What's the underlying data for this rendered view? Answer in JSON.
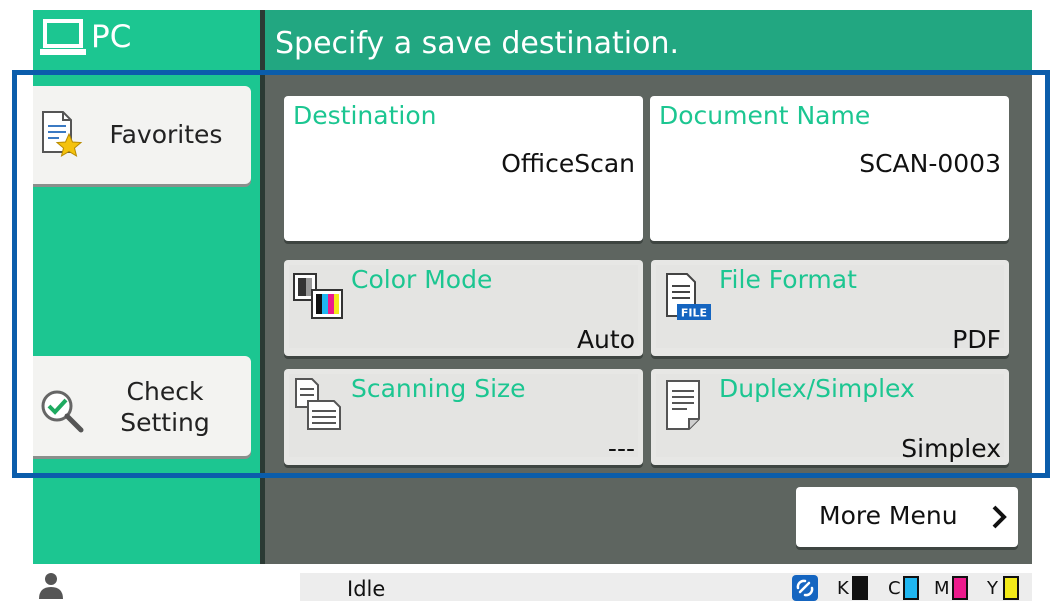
{
  "header": {
    "mode_label": "PC",
    "title": "Specify a save destination."
  },
  "sidebar": {
    "favorites_label": "Favorites",
    "check_setting_line1": "Check",
    "check_setting_line2": "Setting"
  },
  "settings": {
    "destination": {
      "title": "Destination",
      "value": "OfficeScan"
    },
    "document_name": {
      "title": "Document Name",
      "value": "SCAN-0003"
    },
    "color_mode": {
      "title": "Color Mode",
      "value": "Auto"
    },
    "file_format": {
      "title": "File Format",
      "value": "PDF",
      "icon_badge": "FILE"
    },
    "scanning_size": {
      "title": "Scanning Size",
      "value": "---"
    },
    "duplex_simplex": {
      "title": "Duplex/Simplex",
      "value": "Simplex"
    }
  },
  "more_menu_label": "More Menu",
  "status_bar": {
    "status_text": "Idle",
    "toner": [
      {
        "label": "K",
        "color": "#111111"
      },
      {
        "label": "C",
        "color": "#1fb6f0"
      },
      {
        "label": "M",
        "color": "#ec1b8c"
      },
      {
        "label": "Y",
        "color": "#f3ea19"
      }
    ]
  },
  "colors": {
    "accent_green": "#1cc691",
    "header_dark_green": "#22a781",
    "panel_grey": "#5e6560",
    "highlight_blue": "#0b5dab"
  },
  "icons": [
    "pc-icon",
    "favorites-star-icon",
    "check-setting-magnifier-icon",
    "color-mode-icon",
    "file-format-icon",
    "scanning-size-icon",
    "duplex-simplex-icon",
    "chevron-right-icon",
    "user-icon",
    "connection-icon"
  ]
}
